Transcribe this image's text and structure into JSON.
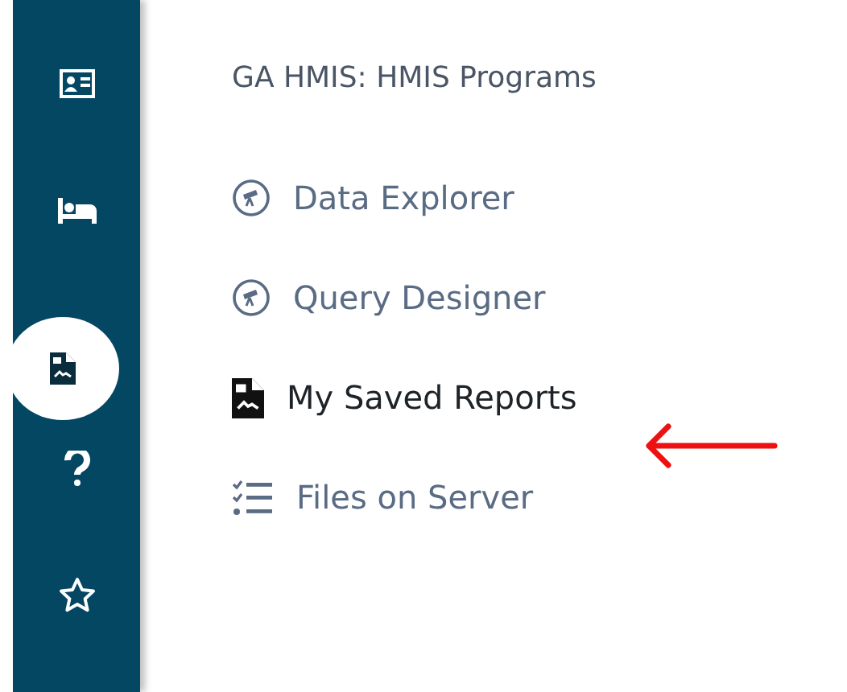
{
  "sidebar": {
    "items": [
      {
        "kind": "id-card",
        "selected": false
      },
      {
        "kind": "bed",
        "selected": false
      },
      {
        "kind": "report",
        "selected": true
      },
      {
        "kind": "help",
        "selected": false
      },
      {
        "kind": "star",
        "selected": false
      }
    ]
  },
  "title": "GA HMIS: HMIS Programs",
  "menu": [
    {
      "label": "Data Explorer",
      "kind": "telescope",
      "selected": false
    },
    {
      "label": "Query Designer",
      "kind": "telescope",
      "selected": false
    },
    {
      "label": "My Saved Reports",
      "kind": "report",
      "selected": true
    },
    {
      "label": "Files on Server",
      "kind": "checklist",
      "selected": false
    }
  ],
  "annotation": {
    "kind": "arrow",
    "color": "#ee1111"
  }
}
